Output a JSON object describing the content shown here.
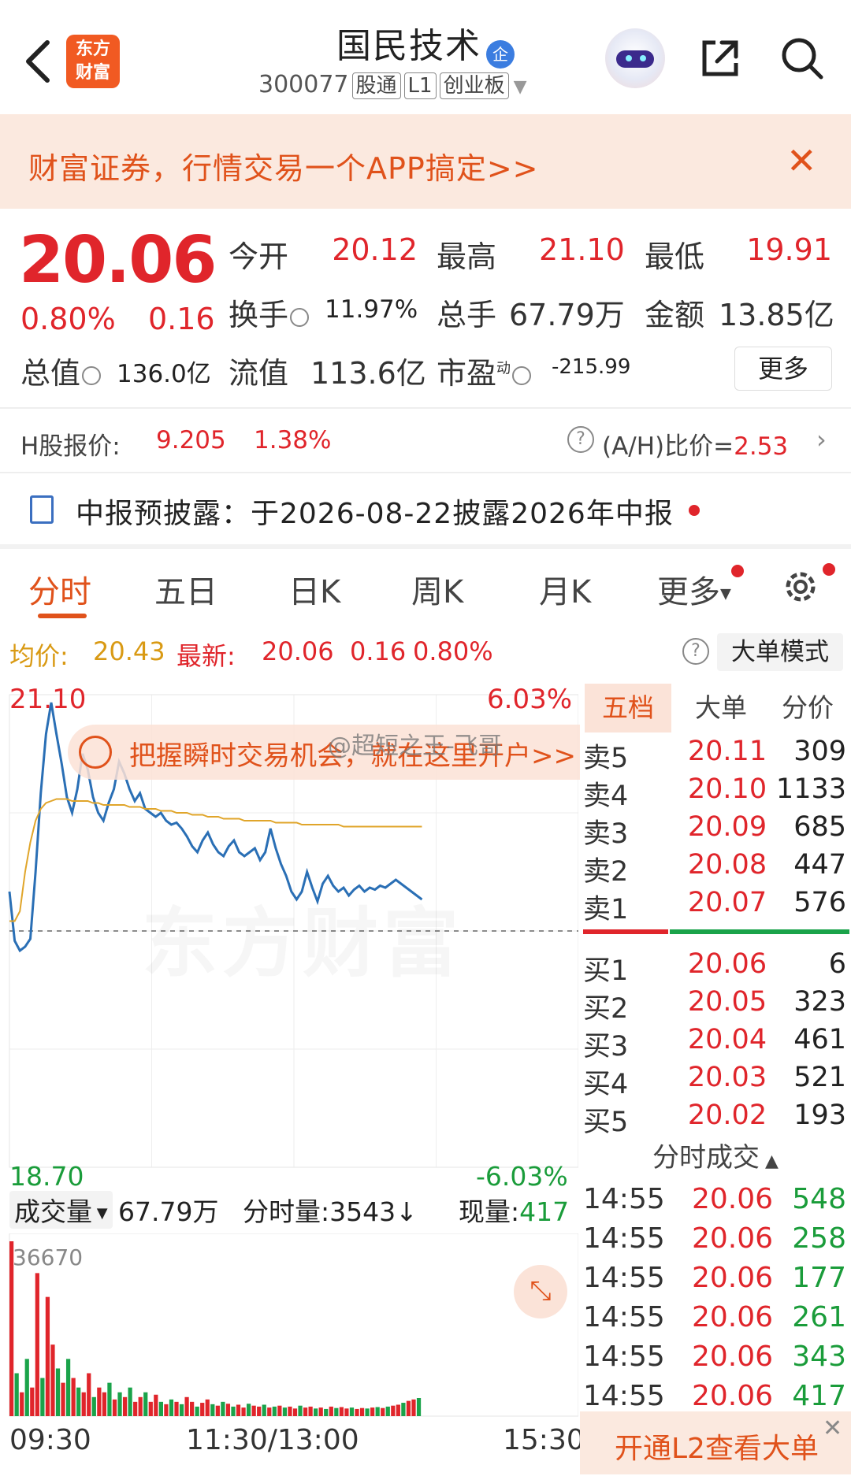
{
  "header": {
    "stock_name": "国民技术",
    "enterprise_badge": "企",
    "code": "300077",
    "tags": [
      "股通",
      "L1",
      "创业板"
    ],
    "logo_text_line1": "东方",
    "logo_text_line2": "财富",
    "icons": [
      "back-chevron-icon",
      "robot-avatar-icon",
      "share-icon",
      "search-icon"
    ]
  },
  "promo_banner": {
    "text": "财富证券，行情交易一个APP搞定>>",
    "close": "✕"
  },
  "quote": {
    "price": "20.06",
    "pct_change": "0.80%",
    "change": "0.16",
    "open_label": "今开",
    "open": "20.12",
    "high_label": "最高",
    "high": "21.10",
    "low_label": "最低",
    "low": "19.91",
    "turnover_label": "换手",
    "turnover": "11.97%",
    "volume_label": "总手",
    "volume": "67.79万",
    "amount_label": "金额",
    "amount": "13.85亿",
    "total_cap_label": "总值",
    "total_cap": "136.0亿",
    "float_cap_label": "流值",
    "float_cap": "113.6亿",
    "pe_label": "市盈",
    "pe_sup": "动",
    "pe": "-215.99",
    "more_button": "更多",
    "up_color": "#e0252b"
  },
  "h_share": {
    "label": "H股报价:",
    "price": "9.205",
    "pct": "1.38%",
    "ah_label": "(A/H)比价=",
    "ah_value": "2.53"
  },
  "report": {
    "text": "中报预披露：于2026-08-22披露2026年中报"
  },
  "tabs": [
    {
      "label": "分时",
      "active": true
    },
    {
      "label": "五日"
    },
    {
      "label": "日K"
    },
    {
      "label": "周K"
    },
    {
      "label": "月K"
    },
    {
      "label": "更多"
    }
  ],
  "avg_row": {
    "avg_label": "均价:",
    "avg_value": "20.43",
    "latest_label": "最新:",
    "latest_value": "20.06",
    "latest_change": "0.16",
    "latest_pct": "0.80%",
    "big_order_mode": "大单模式"
  },
  "chart_data": {
    "type": "line",
    "y_max_label": "21.10",
    "y_min_label": "18.70",
    "pct_max_label": "6.03%",
    "pct_min_label": "-6.03%",
    "ylim": [
      18.7,
      21.1
    ],
    "prev_close": 19.9,
    "x_labels": [
      "09:30",
      "11:30/13:00",
      "15:30"
    ],
    "series": [
      {
        "name": "价格",
        "color": "#2a6fb5",
        "values": [
          20.1,
          19.85,
          19.8,
          19.82,
          19.86,
          20.2,
          20.6,
          20.9,
          21.06,
          20.9,
          20.75,
          20.58,
          20.5,
          20.62,
          20.8,
          20.72,
          20.58,
          20.5,
          20.46,
          20.55,
          20.62,
          20.76,
          20.7,
          20.62,
          20.56,
          20.6,
          20.52,
          20.5,
          20.48,
          20.5,
          20.46,
          20.44,
          20.45,
          20.42,
          20.38,
          20.33,
          20.3,
          20.36,
          20.4,
          20.34,
          20.3,
          20.28,
          20.33,
          20.36,
          20.3,
          20.28,
          20.3,
          20.32,
          20.26,
          20.3,
          20.42,
          20.32,
          20.24,
          20.18,
          20.1,
          20.06,
          20.1,
          20.2,
          20.12,
          20.05,
          20.14,
          20.18,
          20.13,
          20.1,
          20.12,
          20.08,
          20.11,
          20.13,
          20.1,
          20.12,
          20.11,
          20.13,
          20.12,
          20.14,
          20.16,
          20.14,
          20.12,
          20.1,
          20.08,
          20.06
        ]
      },
      {
        "name": "均价",
        "color": "#e0a52a",
        "values": [
          19.95,
          19.95,
          20.0,
          20.2,
          20.35,
          20.46,
          20.52,
          20.55,
          20.56,
          20.57,
          20.57,
          20.57,
          20.56,
          20.56,
          20.56,
          20.56,
          20.55,
          20.55,
          20.54,
          20.54,
          20.54,
          20.54,
          20.54,
          20.53,
          20.53,
          20.53,
          20.52,
          20.52,
          20.52,
          20.51,
          20.51,
          20.51,
          20.5,
          20.5,
          20.5,
          20.49,
          20.49,
          20.49,
          20.48,
          20.48,
          20.48,
          20.47,
          20.47,
          20.47,
          20.47,
          20.46,
          20.46,
          20.46,
          20.46,
          20.46,
          20.46,
          20.45,
          20.45,
          20.45,
          20.45,
          20.45,
          20.44,
          20.44,
          20.44,
          20.44,
          20.44,
          20.44,
          20.44,
          20.44,
          20.43,
          20.43,
          20.43,
          20.43,
          20.43,
          20.43,
          20.43,
          20.43,
          20.43,
          20.43,
          20.43,
          20.43,
          20.43,
          20.43,
          20.43,
          20.43
        ]
      }
    ],
    "volume": {
      "label": "成交量",
      "total": "67.79万",
      "period_label": "分时量:",
      "period_value": "3543",
      "current_label": "现量:",
      "current_value": "417",
      "max_label": "36670",
      "bars": [
        36670,
        9000,
        5000,
        12000,
        6000,
        30000,
        8000,
        25000,
        15000,
        10000,
        7000,
        12000,
        8000,
        6000,
        5000,
        9000,
        4000,
        6000,
        5000,
        7000,
        3500,
        5000,
        4000,
        6000,
        3000,
        4000,
        5000,
        3000,
        4500,
        3000,
        2500,
        3500,
        3000,
        2500,
        4000,
        3000,
        2000,
        2800,
        3500,
        2500,
        2200,
        3000,
        2600,
        2000,
        2400,
        1800,
        2600,
        2200,
        2000,
        2400,
        1800,
        2000,
        2200,
        1800,
        2000,
        1600,
        2200,
        1800,
        2000,
        1600,
        1800,
        1500,
        2000,
        1700,
        1900,
        1600,
        1800,
        1500,
        1700,
        1600,
        1800,
        1900,
        1700,
        2000,
        2200,
        2400,
        2800,
        3200,
        3500,
        3800
      ],
      "bar_colors": [
        "#e0252b",
        "#1aa34a",
        "#e0252b",
        "#1aa34a",
        "#e0252b",
        "#e0252b",
        "#1aa34a",
        "#e0252b",
        "#e0252b",
        "#1aa34a"
      ]
    }
  },
  "chart_promo": {
    "text": "把握瞬时交易机会，就在这里开户>>"
  },
  "watermark": "东方财富",
  "weibo_watermark": "@超短之王-飞哥",
  "order_book": {
    "tabs": [
      "五档",
      "大单",
      "分价"
    ],
    "asks": [
      {
        "label": "卖5",
        "price": "20.11",
        "vol": "309"
      },
      {
        "label": "卖4",
        "price": "20.10",
        "vol": "1133"
      },
      {
        "label": "卖3",
        "price": "20.09",
        "vol": "685"
      },
      {
        "label": "卖2",
        "price": "20.08",
        "vol": "447"
      },
      {
        "label": "卖1",
        "price": "20.07",
        "vol": "576"
      }
    ],
    "bids": [
      {
        "label": "买1",
        "price": "20.06",
        "vol": "6"
      },
      {
        "label": "买2",
        "price": "20.05",
        "vol": "323"
      },
      {
        "label": "买3",
        "price": "20.04",
        "vol": "461"
      },
      {
        "label": "买4",
        "price": "20.03",
        "vol": "521"
      },
      {
        "label": "买5",
        "price": "20.02",
        "vol": "193"
      }
    ],
    "ticks_header": "分时成交",
    "ticks": [
      {
        "time": "14:55",
        "price": "20.06",
        "vol": "548"
      },
      {
        "time": "14:55",
        "price": "20.06",
        "vol": "258"
      },
      {
        "time": "14:55",
        "price": "20.06",
        "vol": "177"
      },
      {
        "time": "14:55",
        "price": "20.06",
        "vol": "261"
      },
      {
        "time": "14:55",
        "price": "20.06",
        "vol": "343"
      },
      {
        "time": "14:55",
        "price": "20.06",
        "vol": "417"
      }
    ],
    "l2_button": "开通L2查看大单",
    "l2_close": "✕"
  }
}
